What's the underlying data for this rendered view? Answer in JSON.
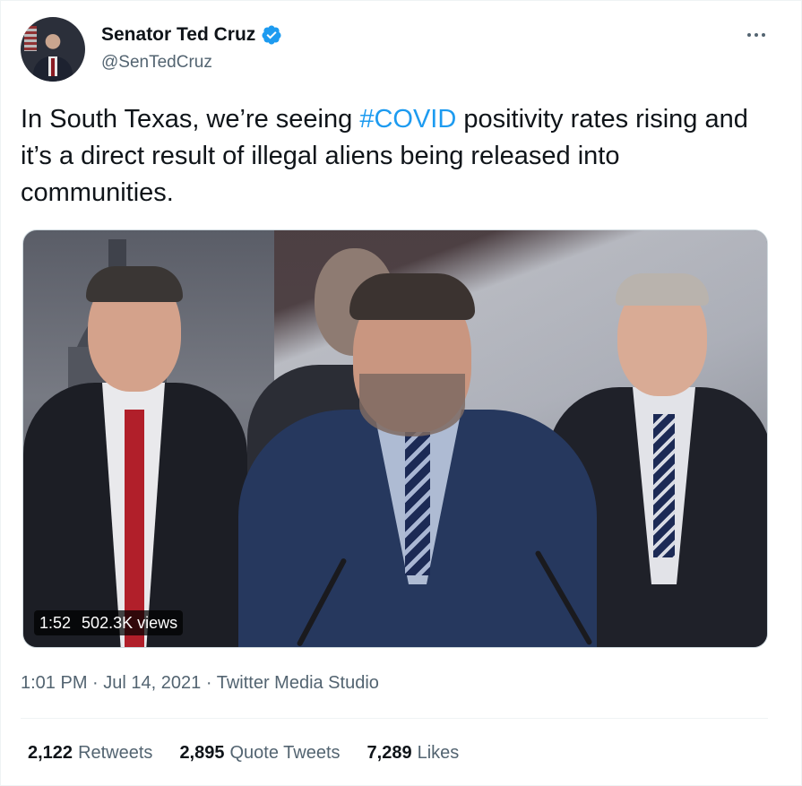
{
  "author": {
    "display_name": "Senator Ted Cruz",
    "handle": "@SenTedCruz",
    "verified": true,
    "verified_icon": "verified-badge-icon"
  },
  "more_icon": "more-options-icon",
  "tweet": {
    "text_before": "In South Texas, we’re seeing ",
    "hashtag": "#COVID",
    "text_after": " positivity rates rising and it’s a direct result of illegal aliens being released into communities."
  },
  "media": {
    "duration": "1:52",
    "views": "502.3K views"
  },
  "meta": {
    "time": "1:01 PM",
    "separator": "·",
    "date": "Jul 14, 2021",
    "source": "Twitter Media Studio"
  },
  "stats": {
    "retweets_count": "2,122",
    "retweets_label": "Retweets",
    "quotes_count": "2,895",
    "quotes_label": "Quote Tweets",
    "likes_count": "7,289",
    "likes_label": "Likes"
  },
  "colors": {
    "accent": "#1d9bf0",
    "text": "#0f1419",
    "muted": "#536471"
  }
}
